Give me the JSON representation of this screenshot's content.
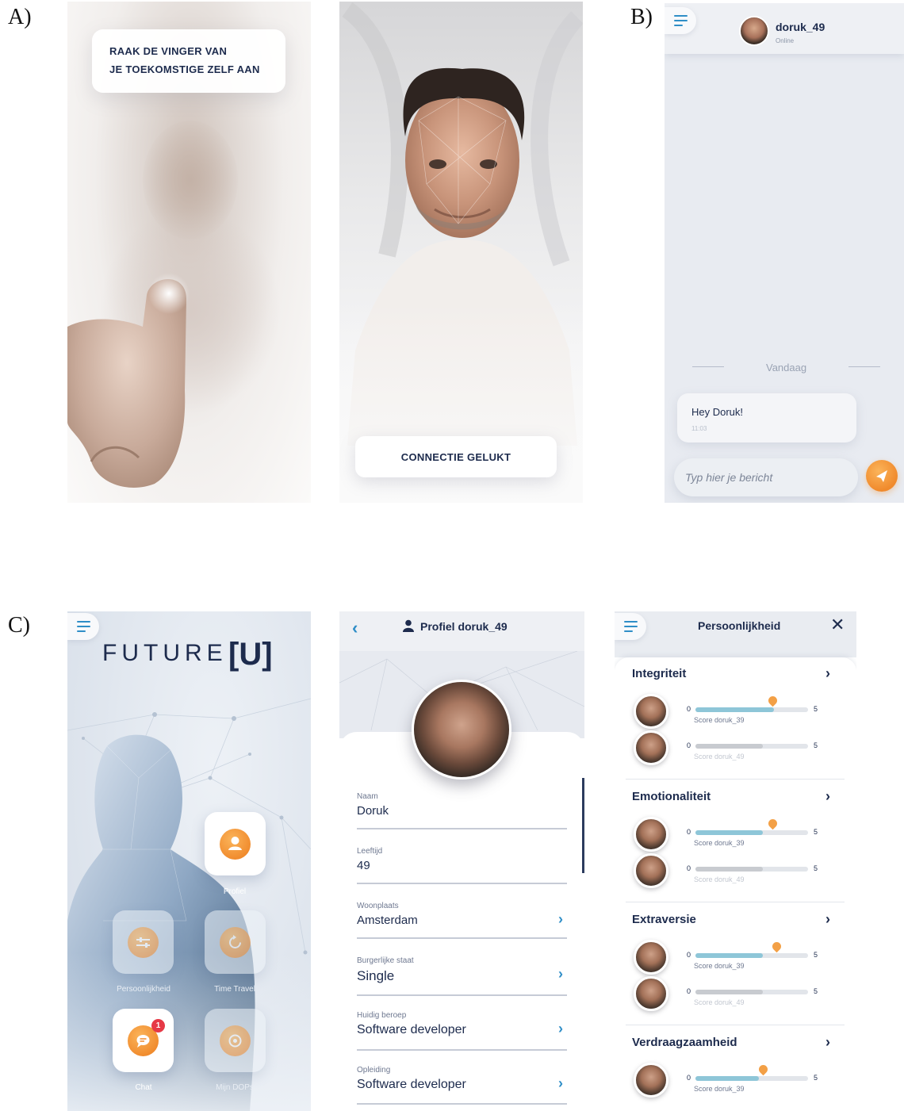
{
  "labels": {
    "a": "A)",
    "b": "B)",
    "c": "C)"
  },
  "colors": {
    "accent_orange": "#f08a2c",
    "accent_blue": "#2f8ec7",
    "navy": "#1d2b4d",
    "bar_blue": "#8ec6d8",
    "bar_gray": "#c8cbd0"
  },
  "a1": {
    "prompt_line1": "RAAK DE VINGER VAN",
    "prompt_line2": "JE TOEKOMSTIGE ZELF AAN"
  },
  "a2": {
    "button_label": "CONNECTIE GELUKT"
  },
  "b": {
    "menu_icon": "hamburger-icon",
    "username": "doruk_49",
    "status": "Online",
    "day_divider": "Vandaag",
    "message_text": "Hey Doruk!",
    "message_time": "11:03",
    "input_placeholder": "Typ hier je bericht",
    "send_icon": "paper-plane-icon"
  },
  "c1": {
    "logo_text": "FUTURE",
    "logo_bracket": "[U]",
    "tiles": [
      {
        "label": "Profiel",
        "icon": "person-icon"
      },
      {
        "label": "Persoonlijkheid",
        "icon": "sliders-icon"
      },
      {
        "label": "Time Travel",
        "icon": "rewind-icon"
      },
      {
        "label": "Chat",
        "icon": "chat-bubble-icon",
        "badge": "1"
      },
      {
        "label": "Mijn DOPs",
        "icon": "target-icon"
      }
    ]
  },
  "c2": {
    "title": "Profiel doruk_49",
    "fields": [
      {
        "label": "Naam",
        "value": "Doruk"
      },
      {
        "label": "Leeftijd",
        "value": "49"
      },
      {
        "label": "Woonplaats",
        "value": "Amsterdam"
      },
      {
        "label": "Burgerlijke staat",
        "value": "Single"
      },
      {
        "label": "Huidig beroep",
        "value": "Software developer"
      },
      {
        "label": "Opleiding",
        "value": "Software developer"
      }
    ]
  },
  "c3": {
    "title": "Persoonlijkheid",
    "scale_min": "0",
    "scale_max": "5",
    "traits": [
      {
        "name": "Integriteit",
        "score_a_label": "Score doruk_39",
        "score_a": 3.5,
        "pin": 3.4,
        "score_b_label": "Score doruk_49",
        "score_b": 3.0
      },
      {
        "name": "Emotionaliteit",
        "score_a_label": "Score doruk_39",
        "score_a": 3.0,
        "pin": 3.4,
        "score_b_label": "Score doruk_49",
        "score_b": 3.0
      },
      {
        "name": "Extraversie",
        "score_a_label": "Score doruk_39",
        "score_a": 3.0,
        "pin": 3.6,
        "score_b_label": "Score doruk_49",
        "score_b": 3.0
      },
      {
        "name": "Verdraagzaamheid",
        "score_a_label": "Score doruk_39",
        "score_a": 2.8,
        "pin": 3.0
      }
    ]
  }
}
